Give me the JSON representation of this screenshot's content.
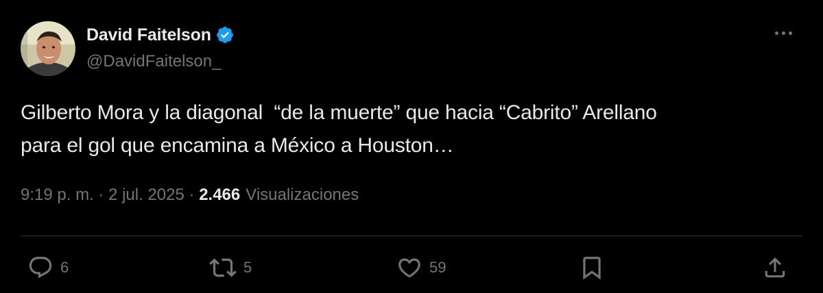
{
  "author": {
    "display_name": "David Faitelson",
    "handle": "@DavidFaitelson_",
    "verified": true,
    "avatar": "avatar-photo"
  },
  "tweet": {
    "text": "Gilberto Mora y la diagonal  “de la muerte” que hacia “Cabrito” Arellano\npara el gol que encamina a México a Houston…",
    "time": "9:19 p. m.",
    "separator": "·",
    "date": "2 jul. 2025",
    "views_count": "2.466",
    "views_label": "Visualizaciones"
  },
  "actions": {
    "reply_count": "6",
    "retweet_count": "5",
    "like_count": "59"
  },
  "icons": {
    "more": "more-horizontal-icon",
    "verified": "verified-badge-icon",
    "reply": "reply-icon",
    "retweet": "retweet-icon",
    "like": "heart-icon",
    "bookmark": "bookmark-icon",
    "share": "share-icon"
  },
  "colors": {
    "background": "#000000",
    "text_primary": "#e7e9ea",
    "text_secondary": "#71767b",
    "verified_blue": "#1d9bf0",
    "divider": "#2f3336"
  }
}
